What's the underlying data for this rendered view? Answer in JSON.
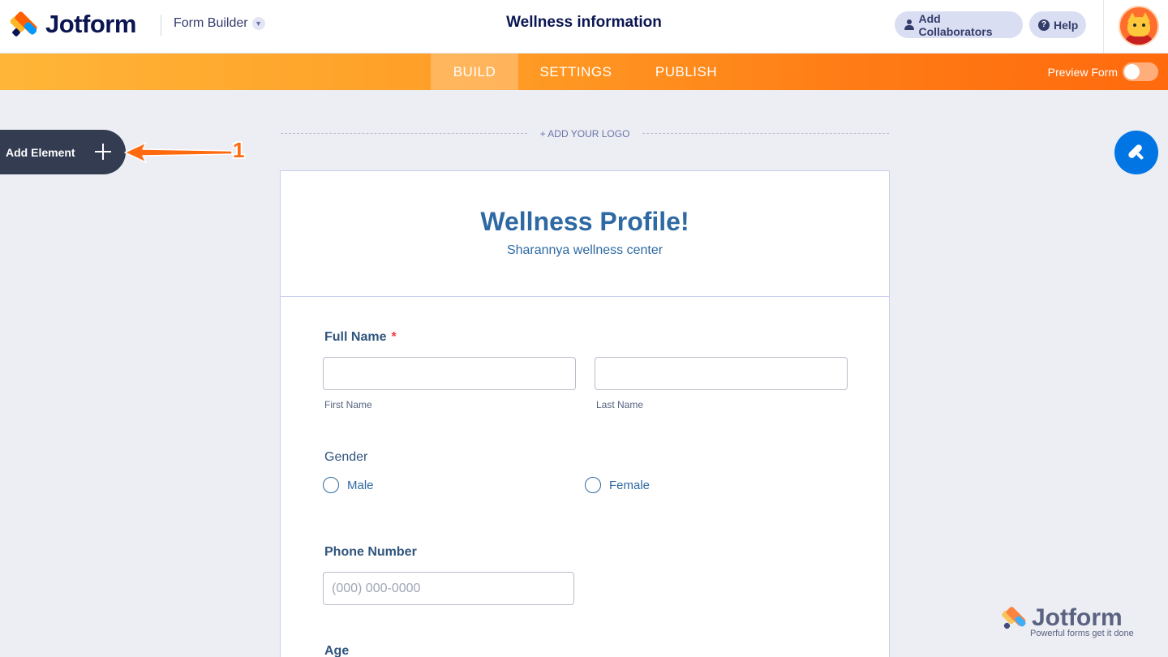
{
  "header": {
    "brand": "Jotform",
    "builder_label": "Form Builder",
    "form_title": "Wellness information",
    "add_collaborators": "Add Collaborators",
    "help": "Help"
  },
  "nav": {
    "tabs": [
      "BUILD",
      "SETTINGS",
      "PUBLISH"
    ],
    "active_tab": "BUILD",
    "preview_label": "Preview Form",
    "preview_enabled": false
  },
  "sidebar": {
    "add_element": "Add Element"
  },
  "annotation": {
    "number": "1"
  },
  "canvas": {
    "add_logo": "+ ADD YOUR LOGO"
  },
  "form": {
    "heading": "Wellness Profile!",
    "subheading": "Sharannya wellness center",
    "full_name": {
      "label": "Full Name",
      "required_mark": "*",
      "first_sublabel": "First Name",
      "last_sublabel": "Last Name"
    },
    "gender": {
      "label": "Gender",
      "options": [
        "Male",
        "Female"
      ]
    },
    "phone": {
      "label": "Phone Number",
      "placeholder": "(000) 000-0000"
    },
    "age": {
      "label": "Age"
    }
  },
  "watermark": {
    "brand": "Jotform",
    "tagline": "Powerful forms get it done"
  },
  "colors": {
    "brand_orange": "#ff6100",
    "navy": "#0a1551",
    "form_blue": "#2e69a3",
    "designer_blue": "#0075e3"
  }
}
